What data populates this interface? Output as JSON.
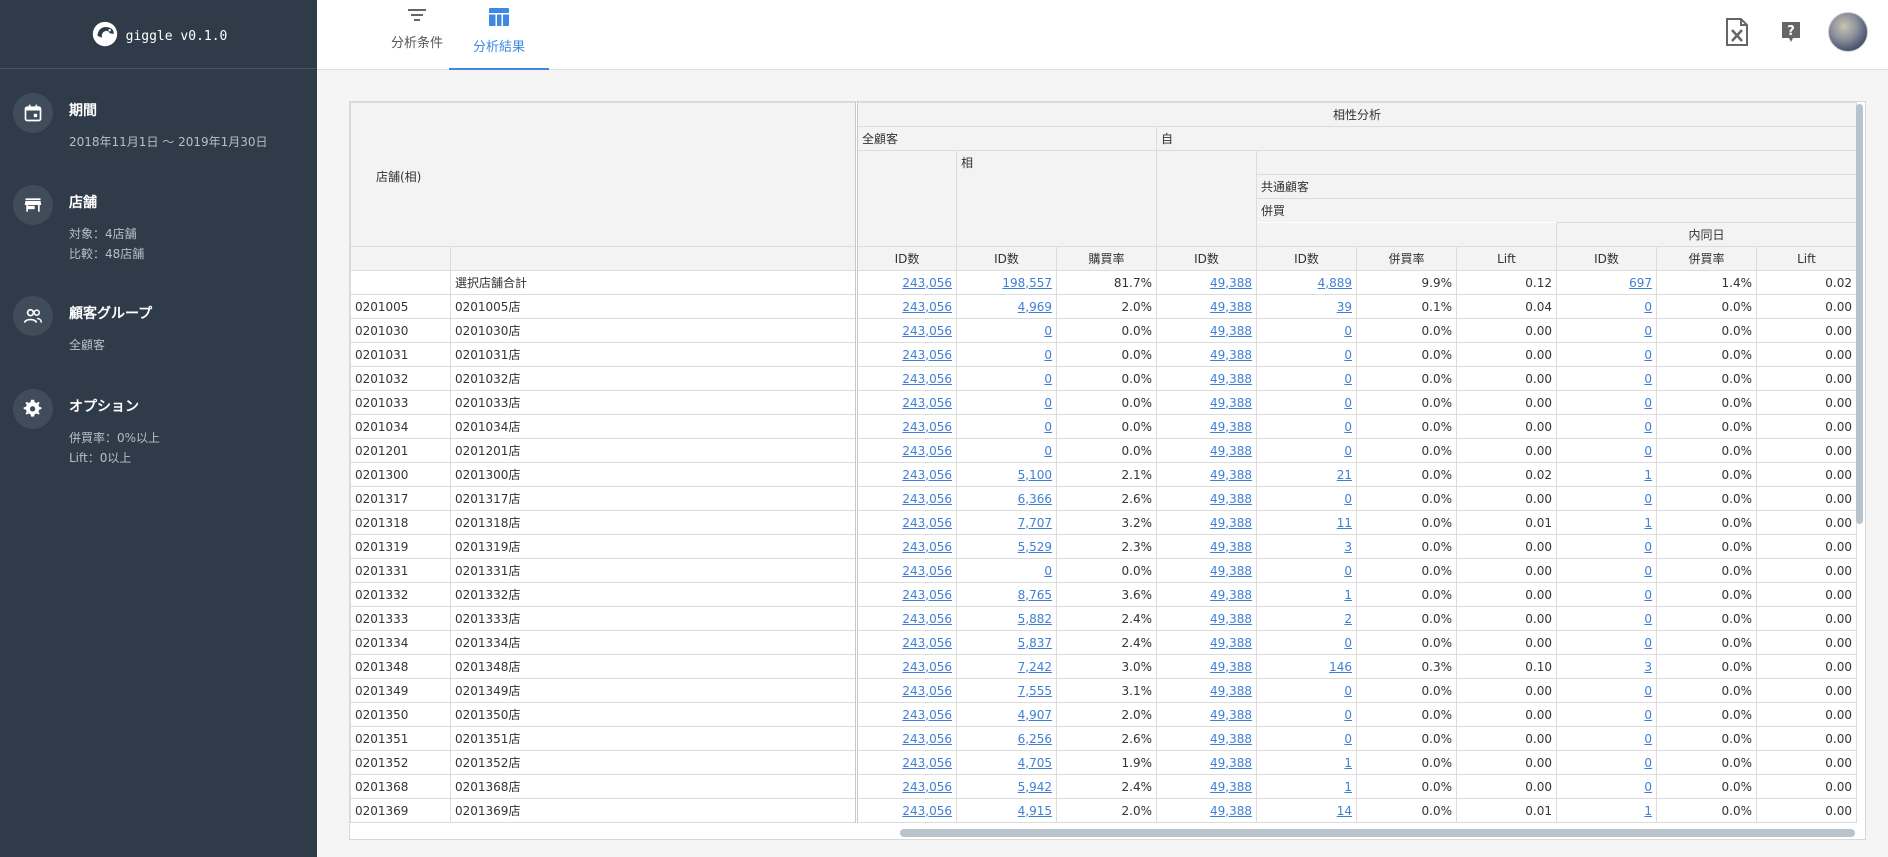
{
  "app": {
    "name": "giggle v0.1.0"
  },
  "sidebar": {
    "sections": [
      {
        "title": "期間",
        "lines": [
          "2018年11月1日 〜 2019年1月30日"
        ],
        "icon": "calendar-icon"
      },
      {
        "title": "店舗",
        "lines": [
          "対象：4店舗",
          "比較：48店舗"
        ],
        "icon": "store-icon"
      },
      {
        "title": "顧客グループ",
        "lines": [
          "全顧客"
        ],
        "icon": "people-icon"
      },
      {
        "title": "オプション",
        "lines": [
          "併買率：0%以上",
          "Lift：0以上"
        ],
        "icon": "gear-icon"
      }
    ]
  },
  "tabs": [
    {
      "label": "分析条件",
      "icon": "filter-icon",
      "active": false
    },
    {
      "label": "分析結果",
      "icon": "table-icon",
      "active": true
    }
  ],
  "top_actions": [
    {
      "name": "excel-export-button",
      "icon": "excel-file-icon"
    },
    {
      "name": "help-button",
      "icon": "help-icon"
    }
  ],
  "table": {
    "header": {
      "store_col": "店舗(相)",
      "group_main": "相性分析",
      "all_customers": "全顧客",
      "partner": "相",
      "self": "自",
      "common_customers": "共通顧客",
      "cross_buy": "併買",
      "same_day": "内同日",
      "cols": [
        "ID数",
        "ID数",
        "購買率",
        "ID数",
        "ID数",
        "併買率",
        "Lift",
        "ID数",
        "併買率",
        "Lift"
      ]
    },
    "rows": [
      {
        "code": "",
        "name": "選択店舗合計",
        "v": [
          "243,056",
          "198,557",
          "81.7%",
          "49,388",
          "4,889",
          "9.9%",
          "0.12",
          "697",
          "1.4%",
          "0.02"
        ]
      },
      {
        "code": "0201005",
        "name": "0201005店",
        "v": [
          "243,056",
          "4,969",
          "2.0%",
          "49,388",
          "39",
          "0.1%",
          "0.04",
          "0",
          "0.0%",
          "0.00"
        ]
      },
      {
        "code": "0201030",
        "name": "0201030店",
        "v": [
          "243,056",
          "0",
          "0.0%",
          "49,388",
          "0",
          "0.0%",
          "0.00",
          "0",
          "0.0%",
          "0.00"
        ]
      },
      {
        "code": "0201031",
        "name": "0201031店",
        "v": [
          "243,056",
          "0",
          "0.0%",
          "49,388",
          "0",
          "0.0%",
          "0.00",
          "0",
          "0.0%",
          "0.00"
        ]
      },
      {
        "code": "0201032",
        "name": "0201032店",
        "v": [
          "243,056",
          "0",
          "0.0%",
          "49,388",
          "0",
          "0.0%",
          "0.00",
          "0",
          "0.0%",
          "0.00"
        ]
      },
      {
        "code": "0201033",
        "name": "0201033店",
        "v": [
          "243,056",
          "0",
          "0.0%",
          "49,388",
          "0",
          "0.0%",
          "0.00",
          "0",
          "0.0%",
          "0.00"
        ]
      },
      {
        "code": "0201034",
        "name": "0201034店",
        "v": [
          "243,056",
          "0",
          "0.0%",
          "49,388",
          "0",
          "0.0%",
          "0.00",
          "0",
          "0.0%",
          "0.00"
        ]
      },
      {
        "code": "0201201",
        "name": "0201201店",
        "v": [
          "243,056",
          "0",
          "0.0%",
          "49,388",
          "0",
          "0.0%",
          "0.00",
          "0",
          "0.0%",
          "0.00"
        ]
      },
      {
        "code": "0201300",
        "name": "0201300店",
        "v": [
          "243,056",
          "5,100",
          "2.1%",
          "49,388",
          "21",
          "0.0%",
          "0.02",
          "1",
          "0.0%",
          "0.00"
        ]
      },
      {
        "code": "0201317",
        "name": "0201317店",
        "v": [
          "243,056",
          "6,366",
          "2.6%",
          "49,388",
          "0",
          "0.0%",
          "0.00",
          "0",
          "0.0%",
          "0.00"
        ]
      },
      {
        "code": "0201318",
        "name": "0201318店",
        "v": [
          "243,056",
          "7,707",
          "3.2%",
          "49,388",
          "11",
          "0.0%",
          "0.01",
          "1",
          "0.0%",
          "0.00"
        ]
      },
      {
        "code": "0201319",
        "name": "0201319店",
        "v": [
          "243,056",
          "5,529",
          "2.3%",
          "49,388",
          "3",
          "0.0%",
          "0.00",
          "0",
          "0.0%",
          "0.00"
        ]
      },
      {
        "code": "0201331",
        "name": "0201331店",
        "v": [
          "243,056",
          "0",
          "0.0%",
          "49,388",
          "0",
          "0.0%",
          "0.00",
          "0",
          "0.0%",
          "0.00"
        ]
      },
      {
        "code": "0201332",
        "name": "0201332店",
        "v": [
          "243,056",
          "8,765",
          "3.6%",
          "49,388",
          "1",
          "0.0%",
          "0.00",
          "0",
          "0.0%",
          "0.00"
        ]
      },
      {
        "code": "0201333",
        "name": "0201333店",
        "v": [
          "243,056",
          "5,882",
          "2.4%",
          "49,388",
          "2",
          "0.0%",
          "0.00",
          "0",
          "0.0%",
          "0.00"
        ]
      },
      {
        "code": "0201334",
        "name": "0201334店",
        "v": [
          "243,056",
          "5,837",
          "2.4%",
          "49,388",
          "0",
          "0.0%",
          "0.00",
          "0",
          "0.0%",
          "0.00"
        ]
      },
      {
        "code": "0201348",
        "name": "0201348店",
        "v": [
          "243,056",
          "7,242",
          "3.0%",
          "49,388",
          "146",
          "0.3%",
          "0.10",
          "3",
          "0.0%",
          "0.00"
        ]
      },
      {
        "code": "0201349",
        "name": "0201349店",
        "v": [
          "243,056",
          "7,555",
          "3.1%",
          "49,388",
          "0",
          "0.0%",
          "0.00",
          "0",
          "0.0%",
          "0.00"
        ]
      },
      {
        "code": "0201350",
        "name": "0201350店",
        "v": [
          "243,056",
          "4,907",
          "2.0%",
          "49,388",
          "0",
          "0.0%",
          "0.00",
          "0",
          "0.0%",
          "0.00"
        ]
      },
      {
        "code": "0201351",
        "name": "0201351店",
        "v": [
          "243,056",
          "6,256",
          "2.6%",
          "49,388",
          "0",
          "0.0%",
          "0.00",
          "0",
          "0.0%",
          "0.00"
        ]
      },
      {
        "code": "0201352",
        "name": "0201352店",
        "v": [
          "243,056",
          "4,705",
          "1.9%",
          "49,388",
          "1",
          "0.0%",
          "0.00",
          "0",
          "0.0%",
          "0.00"
        ]
      },
      {
        "code": "0201368",
        "name": "0201368店",
        "v": [
          "243,056",
          "5,942",
          "2.4%",
          "49,388",
          "1",
          "0.0%",
          "0.00",
          "0",
          "0.0%",
          "0.00"
        ]
      },
      {
        "code": "0201369",
        "name": "0201369店",
        "v": [
          "243,056",
          "4,915",
          "2.0%",
          "49,388",
          "14",
          "0.0%",
          "0.01",
          "1",
          "0.0%",
          "0.00"
        ]
      }
    ]
  },
  "colors": {
    "sidebar_bg": "#2f3b49",
    "accent": "#3f8ae0",
    "link": "#3f7fd6"
  }
}
